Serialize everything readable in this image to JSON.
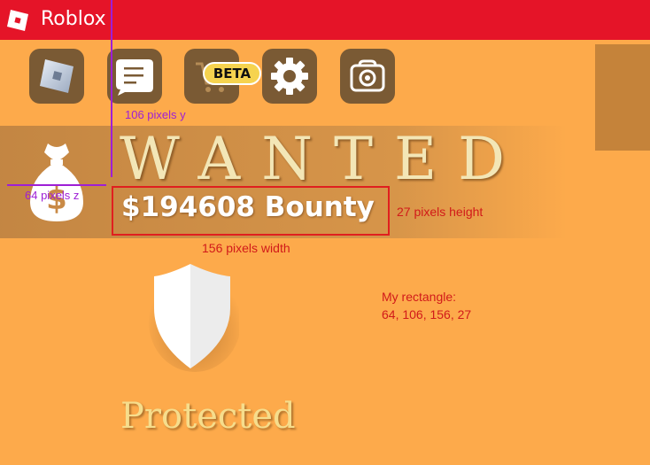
{
  "window": {
    "title": "Roblox",
    "titlebar_color": "#e51428",
    "background_color": "#fdaa4b"
  },
  "toolbar": {
    "buttons": [
      {
        "name": "roblox-logo-button",
        "icon": "roblox-icon"
      },
      {
        "name": "chat-button",
        "icon": "chat-bubble-icon"
      },
      {
        "name": "store-button",
        "icon": "cart-icon",
        "badge": "BETA"
      },
      {
        "name": "settings-button",
        "icon": "gear-icon"
      },
      {
        "name": "camera-button",
        "icon": "camera-icon"
      }
    ]
  },
  "hud": {
    "wanted_label": "WANTED",
    "bounty_text": "$194608 Bounty",
    "moneybag_icon": "money-bag-icon",
    "protected_label": "Protected",
    "shield_icon": "shield-icon"
  },
  "annotations": {
    "y_label": "106 pixels y",
    "z_label": "64 pixels z",
    "height_label": "27 pixels height",
    "width_label": "156 pixels width",
    "rect_title": "My rectangle:",
    "rect_values": "64, 106, 156, 27",
    "annotation_red": "#d11a1a",
    "annotation_purple": "#9e1fd6"
  }
}
